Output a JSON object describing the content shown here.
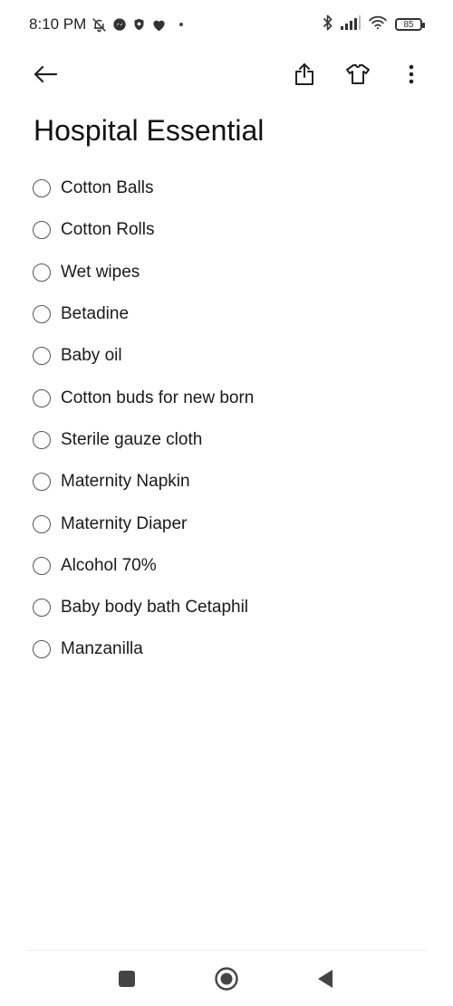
{
  "status_bar": {
    "time": "8:10 PM",
    "battery": "85",
    "left_icons": [
      "bell-off-icon",
      "messenger-icon",
      "shield-icon",
      "heart-icon"
    ],
    "right_icons": [
      "bluetooth-icon",
      "signal-icon",
      "wifi-icon",
      "battery-icon"
    ]
  },
  "toolbar": {
    "icons": [
      "back-arrow-icon",
      "share-icon",
      "shirt-theme-icon",
      "more-vertical-icon"
    ]
  },
  "note": {
    "title": "Hospital Essential",
    "items": [
      {
        "label": "Cotton Balls",
        "checked": false
      },
      {
        "label": "Cotton Rolls",
        "checked": false
      },
      {
        "label": "Wet wipes",
        "checked": false
      },
      {
        "label": "Betadine",
        "checked": false
      },
      {
        "label": "Baby oil",
        "checked": false
      },
      {
        "label": "Cotton buds for new born",
        "checked": false
      },
      {
        "label": "Sterile gauze cloth",
        "checked": false
      },
      {
        "label": "Maternity Napkin",
        "checked": false
      },
      {
        "label": "Maternity Diaper",
        "checked": false
      },
      {
        "label": "Alcohol 70%",
        "checked": false
      },
      {
        "label": "Baby body bath Cetaphil",
        "checked": false
      },
      {
        "label": "Manzanilla",
        "checked": false
      }
    ]
  },
  "nav_bar": {
    "icons": [
      "recents-square-icon",
      "home-circle-icon",
      "back-triangle-icon"
    ]
  },
  "colors": {
    "background": "#ffffff",
    "text": "#111111",
    "icon": "#333333"
  }
}
